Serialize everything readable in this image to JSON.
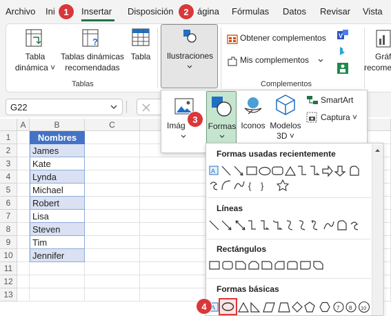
{
  "menu": {
    "items": [
      "Archivo",
      "Inicio",
      "Insertar",
      "Disposición de página",
      "Fórmulas",
      "Datos",
      "Revisar",
      "Vista"
    ],
    "visible_labels": [
      "Archivo",
      "Ini",
      "Insertar",
      "Disposición",
      "ágina",
      "Fórmulas",
      "Datos",
      "Revisar",
      "Vista"
    ],
    "active": "Insertar"
  },
  "ribbon": {
    "tabla_dinamica": [
      "Tabla",
      "dinámica ˅"
    ],
    "tablas_recomendadas": [
      "Tablas dinámicas",
      "recomendadas"
    ],
    "tabla": "Tabla",
    "tablas_group": "Tablas",
    "ilustraciones": "Ilustraciones",
    "obtener_complementos": "Obtener complementos",
    "mis_complementos": "Mis complementos",
    "complementos_group": "Complementos",
    "graf_partial": [
      "Gráf",
      "recome"
    ]
  },
  "formula_bar": {
    "name_box": "G22"
  },
  "ilustraciones_menu": {
    "imagenes": "Imág",
    "formas": "Formas",
    "iconos": "Iconos",
    "modelos": [
      "Modelos",
      "3D ˅"
    ],
    "smartart": "SmartArt",
    "captura": "Captura ˅"
  },
  "sheet": {
    "columns": [
      "A",
      "B",
      "C"
    ],
    "rows": [
      "1",
      "2",
      "3",
      "4",
      "5",
      "6",
      "7",
      "8",
      "9",
      "10",
      "11",
      "12",
      "13"
    ],
    "header": "Nombres",
    "names": [
      "James",
      "Kate",
      "Lynda",
      "Michael",
      "Robert",
      "Lisa",
      "Steven",
      "Tim",
      "Jennifer"
    ]
  },
  "shapes_gallery": {
    "sections": [
      "Formas usadas recientemente",
      "Líneas",
      "Rectángulos",
      "Formas básicas"
    ]
  },
  "steps": [
    "1",
    "2",
    "3",
    "4"
  ],
  "colors": {
    "accent": "#217346",
    "badge": "#d9383a",
    "header_fill": "#4472c4",
    "name_fill": "#d9e1f2"
  }
}
